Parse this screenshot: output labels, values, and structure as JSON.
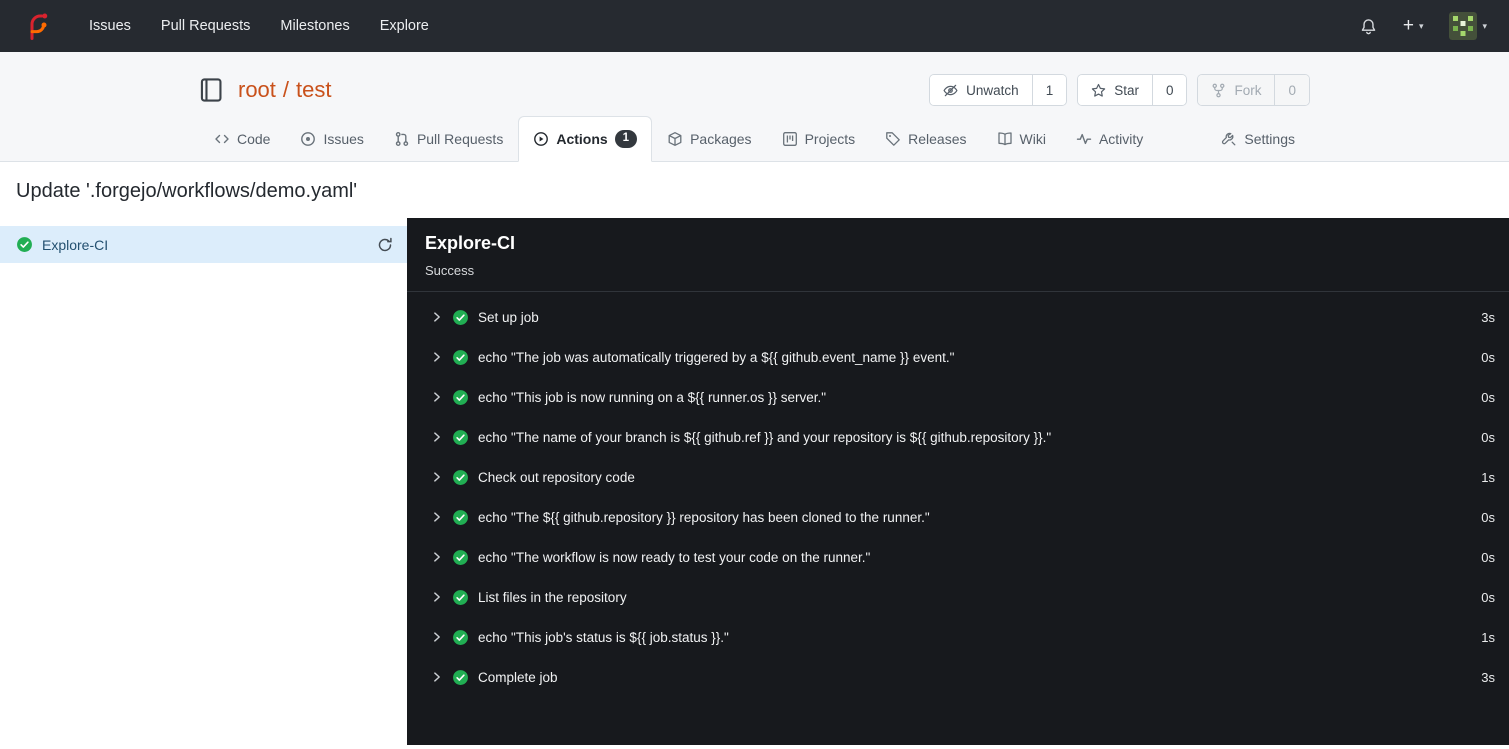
{
  "colors": {
    "accent_link": "#c9511b",
    "success_green": "#21ae53",
    "navbar_bg": "#262a30",
    "panel_bg": "#17191d",
    "selected_job_bg": "#dcedfb"
  },
  "icons": {
    "logo": "forgejo-logo",
    "notifications": "bell-icon",
    "create": "plus-icon",
    "user_menu_caret": "chevron-down-icon"
  },
  "navbar": {
    "items": [
      {
        "label": "Issues"
      },
      {
        "label": "Pull Requests"
      },
      {
        "label": "Milestones"
      },
      {
        "label": "Explore"
      }
    ],
    "create_label": "+",
    "caret": "▾"
  },
  "repo": {
    "owner": "root",
    "separator": "/",
    "name": "test",
    "buttons": [
      {
        "label": "Unwatch",
        "count": "1"
      },
      {
        "label": "Star",
        "count": "0"
      },
      {
        "label": "Fork",
        "count": "0",
        "disabled": true
      }
    ]
  },
  "tabs": [
    {
      "label": "Code",
      "icon": "code-icon"
    },
    {
      "label": "Issues",
      "icon": "issue-circle-icon"
    },
    {
      "label": "Pull Requests",
      "icon": "pull-request-icon"
    },
    {
      "label": "Actions",
      "icon": "play-circle-icon",
      "badge": "1",
      "active": true
    },
    {
      "label": "Packages",
      "icon": "package-icon"
    },
    {
      "label": "Projects",
      "icon": "project-board-icon"
    },
    {
      "label": "Releases",
      "icon": "tag-icon"
    },
    {
      "label": "Wiki",
      "icon": "book-open-icon"
    },
    {
      "label": "Activity",
      "icon": "pulse-icon"
    },
    {
      "label": "Settings",
      "icon": "tools-icon"
    }
  ],
  "page": {
    "title": "Update '.forgejo/workflows/demo.yaml'"
  },
  "sidebar": {
    "jobs": [
      {
        "label": "Explore-CI",
        "status": "success"
      }
    ]
  },
  "run_panel": {
    "job_name": "Explore-CI",
    "status": "Success",
    "steps": [
      {
        "label": "Set up job",
        "duration": "3s"
      },
      {
        "label": "echo \"The job was automatically triggered by a ${{ github.event_name }} event.\"",
        "duration": "0s"
      },
      {
        "label": "echo \"This job is now running on a ${{ runner.os }} server.\"",
        "duration": "0s"
      },
      {
        "label": "echo \"The name of your branch is ${{ github.ref }} and your repository is ${{ github.repository }}.\"",
        "duration": "0s"
      },
      {
        "label": "Check out repository code",
        "duration": "1s"
      },
      {
        "label": "echo \"The ${{ github.repository }} repository has been cloned to the runner.\"",
        "duration": "0s"
      },
      {
        "label": "echo \"The workflow is now ready to test your code on the runner.\"",
        "duration": "0s"
      },
      {
        "label": "List files in the repository",
        "duration": "0s"
      },
      {
        "label": "echo \"This job's status is ${{ job.status }}.\"",
        "duration": "1s"
      },
      {
        "label": "Complete job",
        "duration": "3s"
      }
    ]
  }
}
